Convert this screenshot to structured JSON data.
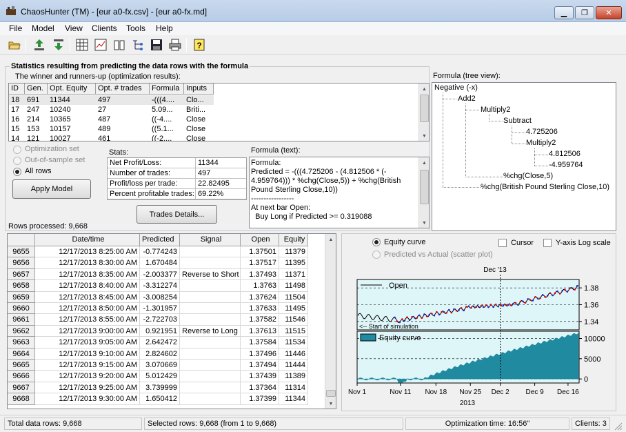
{
  "window": {
    "title": "ChaosHunter (TM) - [eur a0-fx.csv] - [eur a0-fx.md]"
  },
  "menu": [
    "File",
    "Model",
    "View",
    "Clients",
    "Tools",
    "Help"
  ],
  "stats_group_title": "Statistics resulting from predicting the data rows with the formula",
  "winners": {
    "label": "The winner and runners-up (optimization results):",
    "columns": [
      "ID",
      "Gen.",
      "Opt. Equity",
      "Opt. # trades",
      "Formula",
      "Inputs"
    ],
    "rows": [
      [
        "18",
        "691",
        "11344",
        "497",
        "-(((4....",
        "Clo..."
      ],
      [
        "17",
        "247",
        "10240",
        "27",
        "5.09...",
        "Briti..."
      ],
      [
        "16",
        "214",
        "10365",
        "487",
        "((-4....",
        "Close"
      ],
      [
        "15",
        "153",
        "10157",
        "489",
        "((5.1...",
        "Close"
      ],
      [
        "14",
        "121",
        "10027",
        "461",
        "((-2....",
        "Close"
      ]
    ]
  },
  "radios": {
    "optimization_set": "Optimization set",
    "out_of_sample": "Out-of-sample set",
    "all_rows": "All rows"
  },
  "apply_model_label": "Apply Model",
  "stats": {
    "label": "Stats:",
    "rows": [
      {
        "k": "Net Profit/Loss:",
        "v": "11344"
      },
      {
        "k": "Number of trades:",
        "v": "497"
      },
      {
        "k": "Profit/loss per trade:",
        "v": "22.82495"
      },
      {
        "k": "Percent profitable trades:",
        "v": "69.22%"
      }
    ]
  },
  "trades_details_label": "Trades Details...",
  "formula_text": {
    "label": "Formula (text):",
    "lines": [
      "Formula:",
      "Predicted = -(((4.725206 - (4.812506 * (-",
      "4.959764))) * %chg(Close,5)) + %chg(British",
      "Pound Sterling Close,10))",
      "-----------------",
      "At next bar Open:",
      "  Buy Long if Predicted >= 0.319088"
    ]
  },
  "formula_tree": {
    "label": "Formula (tree view):",
    "nodes": [
      "Negative (-x)",
      "Add2",
      "Multiply2",
      "Subtract",
      "4.725206",
      "Multiply2",
      "4.812506",
      "-4.959764",
      "%chg(Close,5)",
      "%chg(British Pound Sterling Close,10)"
    ]
  },
  "rows_processed": "Rows processed: 9,668",
  "data_grid": {
    "columns": [
      "Date/time",
      "Predicted",
      "Signal",
      "Open",
      "Equity"
    ],
    "rows": [
      [
        "9655",
        "12/17/2013 8:25:00 AM",
        "-0.774243",
        "",
        "1.37501",
        "11379"
      ],
      [
        "9656",
        "12/17/2013 8:30:00 AM",
        "1.670484",
        "",
        "1.37517",
        "11395"
      ],
      [
        "9657",
        "12/17/2013 8:35:00 AM",
        "-2.003377",
        "Reverse to Short",
        "1.37493",
        "11371"
      ],
      [
        "9658",
        "12/17/2013 8:40:00 AM",
        "-3.312274",
        "",
        "1.3763",
        "11498"
      ],
      [
        "9659",
        "12/17/2013 8:45:00 AM",
        "-3.008254",
        "",
        "1.37624",
        "11504"
      ],
      [
        "9660",
        "12/17/2013 8:50:00 AM",
        "-1.301957",
        "",
        "1.37633",
        "11495"
      ],
      [
        "9661",
        "12/17/2013 8:55:00 AM",
        "-2.722703",
        "",
        "1.37582",
        "11546"
      ],
      [
        "9662",
        "12/17/2013 9:00:00 AM",
        "0.921951",
        "Reverse to Long",
        "1.37613",
        "11515"
      ],
      [
        "9663",
        "12/17/2013 9:05:00 AM",
        "2.642472",
        "",
        "1.37584",
        "11534"
      ],
      [
        "9664",
        "12/17/2013 9:10:00 AM",
        "2.824602",
        "",
        "1.37496",
        "11446"
      ],
      [
        "9665",
        "12/17/2013 9:15:00 AM",
        "3.070669",
        "",
        "1.37494",
        "11444"
      ],
      [
        "9666",
        "12/17/2013 9:20:00 AM",
        "5.012429",
        "",
        "1.37439",
        "11389"
      ],
      [
        "9667",
        "12/17/2013 9:25:00 AM",
        "3.739999",
        "",
        "1.37364",
        "11314"
      ],
      [
        "9668",
        "12/17/2013 9:30:00 AM",
        "1.650412",
        "",
        "1.37399",
        "11344"
      ]
    ]
  },
  "chart_options": {
    "equity_curve": "Equity curve",
    "scatter": "Predicted vs Actual (scatter plot)",
    "cursor": "Cursor",
    "ylog": "Y-axis Log scale"
  },
  "chart_data": {
    "type": "line",
    "top_label": "Dec '13",
    "xlabel": "2013",
    "x_ticks": [
      "Nov 1",
      "Nov 11",
      "Nov 18",
      "Nov 25",
      "Dec 2",
      "Dec 9",
      "Dec 16"
    ],
    "price_panel": {
      "legend": "Open",
      "annotation": "<-- Start of simulation",
      "y_ticks": [
        "1.38",
        "1.36",
        "1.34"
      ],
      "ylim": [
        1.33,
        1.39
      ]
    },
    "equity_panel": {
      "legend": "Equity curve",
      "y_ticks": [
        "10000",
        "5000",
        "0"
      ],
      "ylim": [
        -1000,
        11800
      ]
    }
  },
  "status": {
    "total": "Total data rows: 9,668",
    "selected": "Selected rows: 9,668  (from 1 to 9,668)",
    "opt_time": "Optimization time: 16:56\"",
    "clients": "Clients: 3"
  }
}
